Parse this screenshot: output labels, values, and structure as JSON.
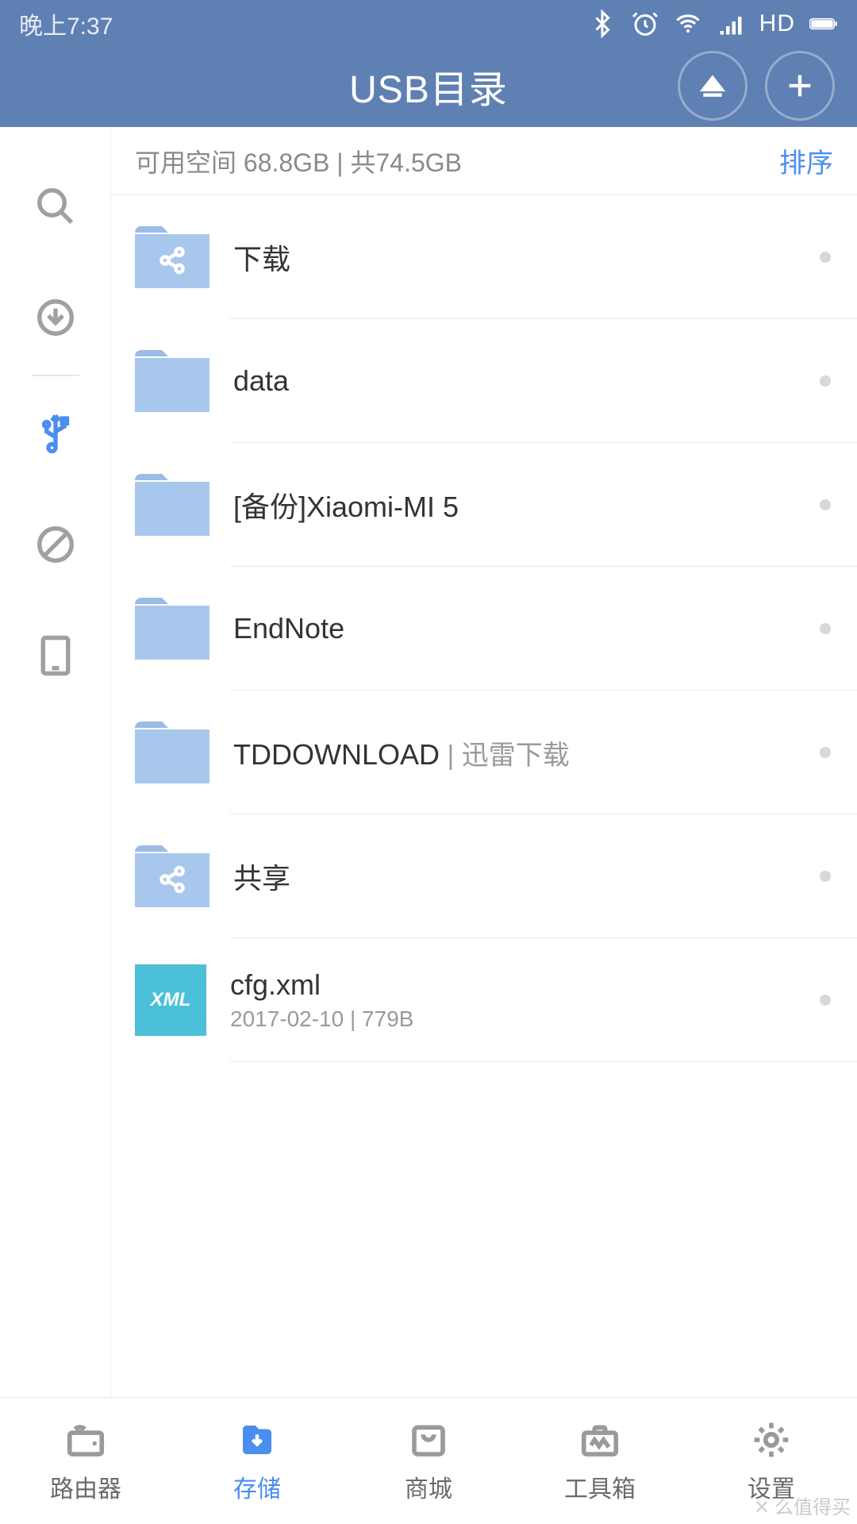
{
  "status": {
    "time": "晚上7:37",
    "hd_label": "HD"
  },
  "header": {
    "title": "USB目录"
  },
  "storage": {
    "line": "可用空间 68.8GB | 共74.5GB",
    "sort_label": "排序"
  },
  "files": {
    "item0": {
      "name": "下载",
      "type": "share-folder"
    },
    "item1": {
      "name": "data",
      "type": "folder"
    },
    "item2": {
      "name": "[备份]Xiaomi-MI 5",
      "type": "folder"
    },
    "item3": {
      "name": "EndNote",
      "type": "folder"
    },
    "item4": {
      "name": "TDDOWNLOAD",
      "secondary": " | 迅雷下载",
      "type": "folder"
    },
    "item5": {
      "name": "共享",
      "type": "share-folder"
    },
    "item6": {
      "name": "cfg.xml",
      "sub": "2017-02-10 | 779B",
      "type": "xml",
      "badge": "XML"
    }
  },
  "nav": {
    "item0": "路由器",
    "item1": "存储",
    "item2": "商城",
    "item3": "工具箱",
    "item4": "设置"
  },
  "watermark": "么值得买"
}
